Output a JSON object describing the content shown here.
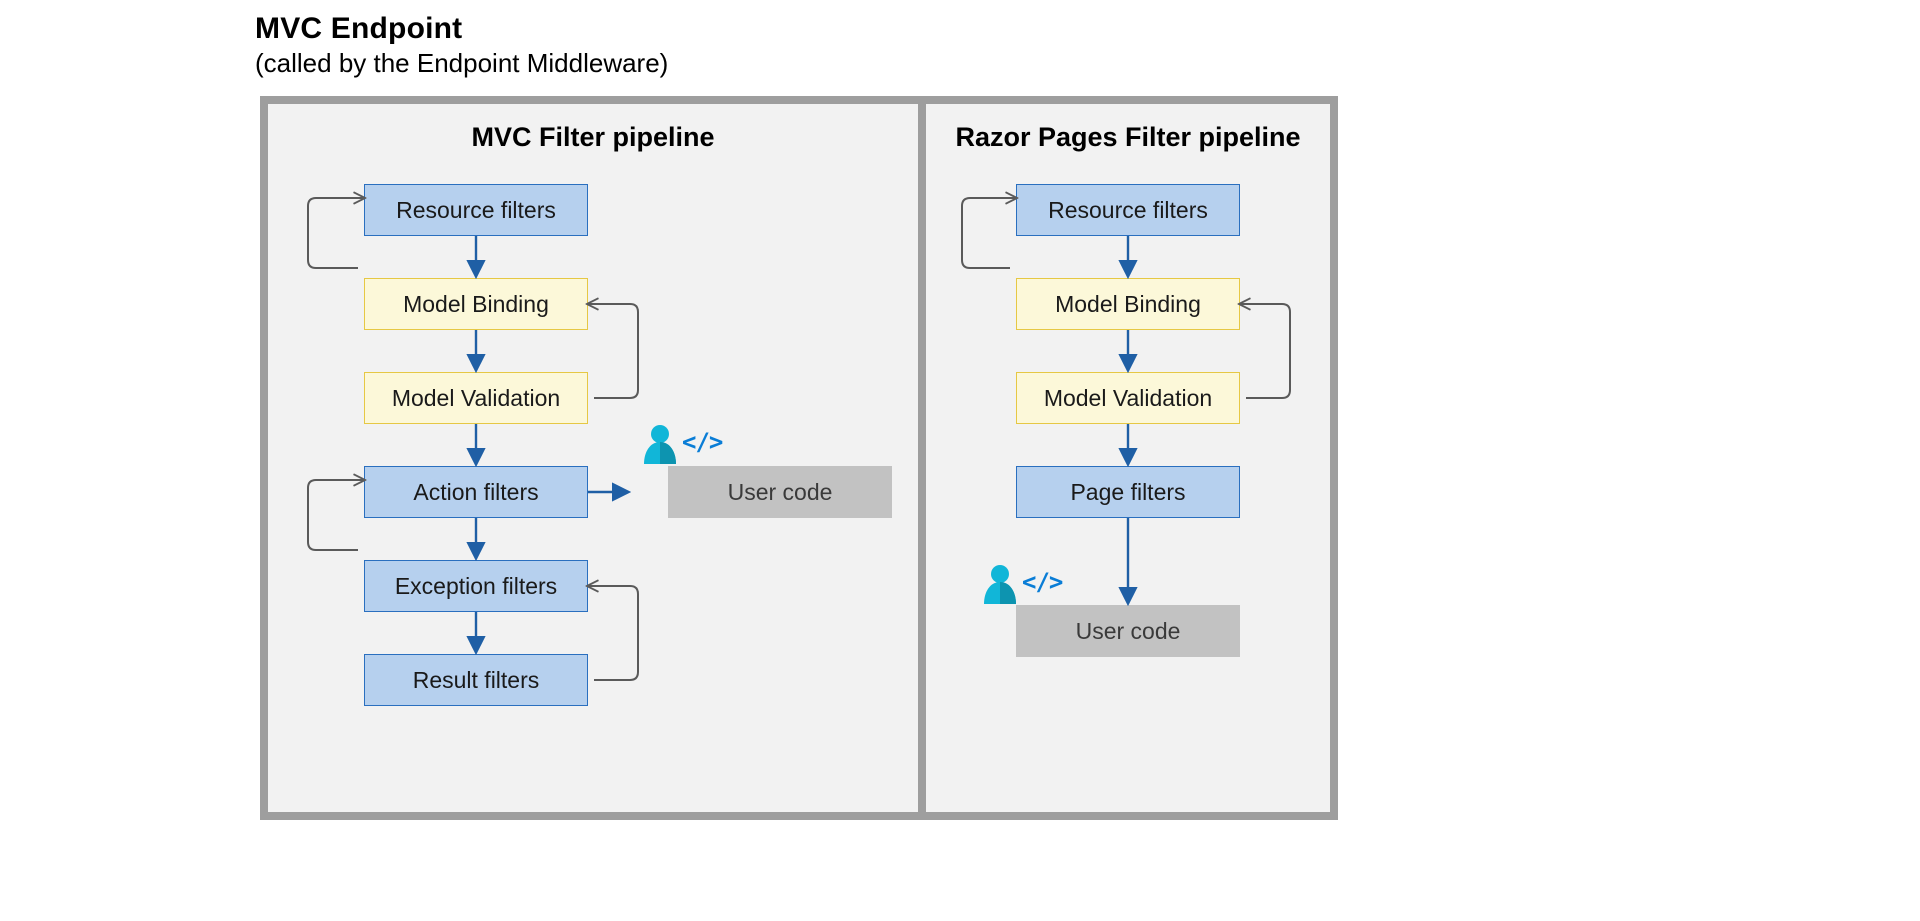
{
  "header": {
    "title": "MVC Endpoint",
    "subtitle": "(called by the Endpoint Middleware)"
  },
  "mvc": {
    "pane_title": "MVC Filter pipeline",
    "boxes": {
      "resource": "Resource filters",
      "model_binding": "Model Binding",
      "model_validation": "Model Validation",
      "action": "Action filters",
      "exception": "Exception filters",
      "result": "Result filters",
      "user_code": "User code"
    }
  },
  "razor": {
    "pane_title": "Razor Pages Filter pipeline",
    "boxes": {
      "resource": "Resource filters",
      "model_binding": "Model Binding",
      "model_validation": "Model Validation",
      "page": "Page filters",
      "user_code": "User code"
    }
  },
  "glyph": {
    "code": "</>"
  },
  "colors": {
    "border": "#9e9e9e",
    "background_panel": "#f2f2f2",
    "box_blue": "#b6d0ee",
    "box_yellow": "#fcf8d9",
    "box_gray": "#c2c2c2",
    "arrow_color": "#1f5fa5",
    "arrow_gray": "#5a5a5a"
  }
}
